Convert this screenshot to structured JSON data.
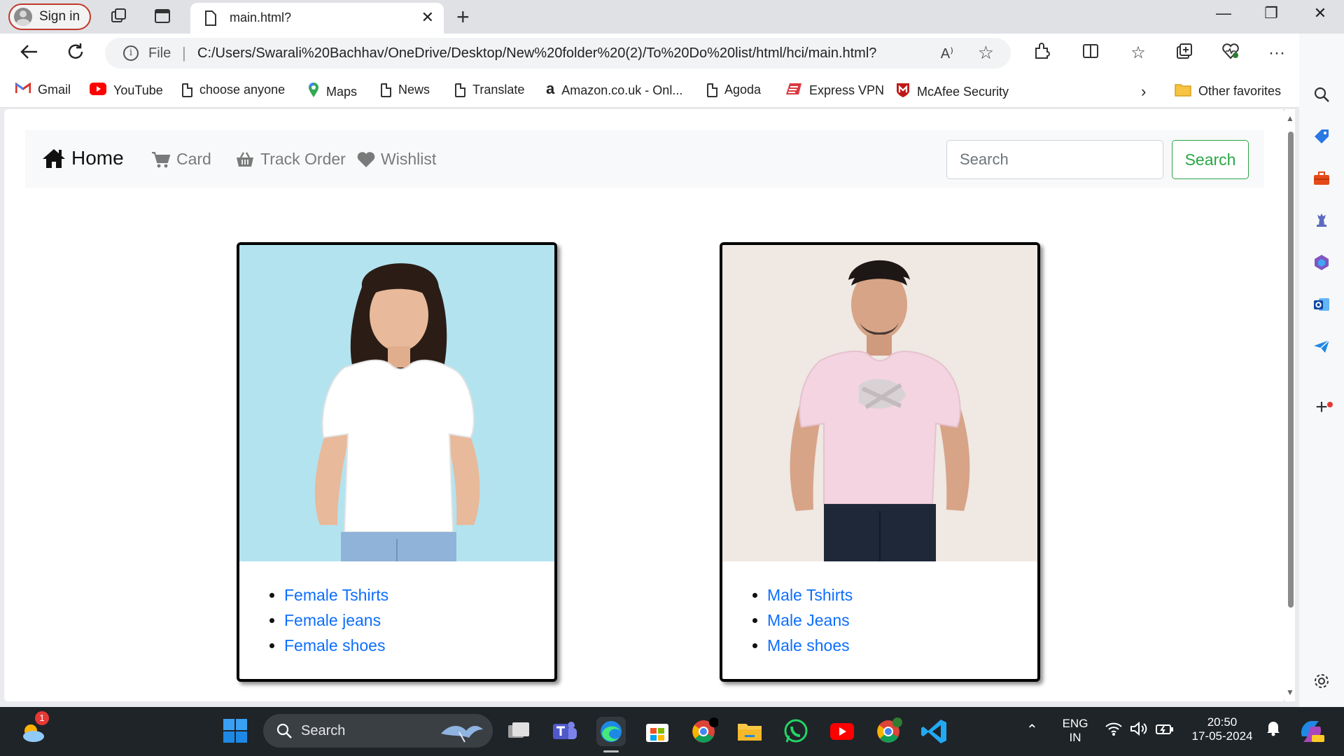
{
  "browser": {
    "signin_label": "Sign in",
    "tab_title": "main.html?",
    "address": {
      "scheme_label": "File",
      "url": "C:/Users/Swarali%20Bachhav/OneDrive/Desktop/New%20folder%20(2)/To%20Do%20list/html/hci/main.html?",
      "read_aloud_glyph": "A⁾"
    },
    "favorites": [
      {
        "label": "Gmail",
        "icon": "gmail-icon"
      },
      {
        "label": "YouTube",
        "icon": "youtube-icon"
      },
      {
        "label": "choose anyone",
        "icon": "document-icon"
      },
      {
        "label": "Maps",
        "icon": "maps-pin-icon"
      },
      {
        "label": "News",
        "icon": "document-icon"
      },
      {
        "label": "Translate",
        "icon": "document-icon"
      },
      {
        "label": "Amazon.co.uk - Onl...",
        "icon": "amazon-icon"
      },
      {
        "label": "Agoda",
        "icon": "document-icon"
      },
      {
        "label": "Express VPN",
        "icon": "expressvpn-icon"
      },
      {
        "label": "McAfee Security",
        "icon": "mcafee-icon"
      }
    ],
    "other_favorites_label": "Other favorites"
  },
  "site": {
    "nav": {
      "home_label": "Home",
      "card_label": "Card",
      "track_order_label": "Track Order",
      "wishlist_label": "Wishlist",
      "search_placeholder": "Search",
      "search_button_label": "Search"
    },
    "cards": [
      {
        "name": "female",
        "photo_bg": "#b3e3ef",
        "links": [
          "Female Tshirts",
          "Female jeans",
          "Female shoes"
        ]
      },
      {
        "name": "male",
        "photo_bg": "#efe8e3",
        "links": [
          "Male Tshirts",
          "Male Jeans",
          "Male shoes"
        ]
      }
    ]
  },
  "taskbar": {
    "search_label": "Search",
    "weather_badge": "1",
    "language_line1": "ENG",
    "language_line2": "IN",
    "time": "20:50",
    "date": "17-05-2024"
  },
  "colors": {
    "link": "#0d6efd",
    "search_button": "#28a745",
    "navbar_bg": "#f8f9fa",
    "taskbar_bg": "#1f2428"
  }
}
